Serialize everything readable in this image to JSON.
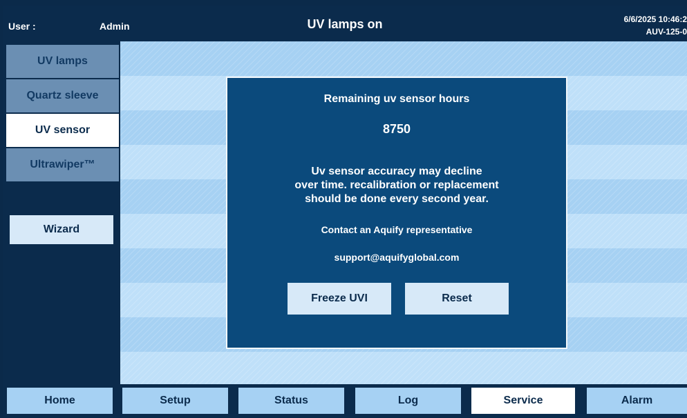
{
  "header": {
    "user_label": "User :",
    "user_name": "Admin",
    "title": "UV lamps on",
    "datetime": "6/6/2025 10:46:2",
    "device_id": "AUV-125-0"
  },
  "sidebar": {
    "items": [
      {
        "label": "UV lamps",
        "active": false
      },
      {
        "label": "Quartz sleeve",
        "active": false
      },
      {
        "label": "UV sensor",
        "active": true
      },
      {
        "label": "Ultrawiper™",
        "active": false
      }
    ],
    "wizard_label": "Wizard"
  },
  "dialog": {
    "title": "Remaining uv sensor hours",
    "value": "8750",
    "message_lines": [
      "Uv sensor accuracy may decline",
      "over time. recalibration or replacement",
      "should be done every second year."
    ],
    "contact": "Contact an Aquify representative",
    "email": "support@aquifyglobal.com",
    "freeze_label": "Freeze UVI",
    "reset_label": "Reset"
  },
  "bottom_nav": {
    "items": [
      {
        "label": "Home",
        "active": false
      },
      {
        "label": "Setup",
        "active": false
      },
      {
        "label": "Status",
        "active": false
      },
      {
        "label": "Log",
        "active": false
      },
      {
        "label": "Service",
        "active": true
      },
      {
        "label": "Alarm",
        "active": false
      }
    ]
  },
  "colors": {
    "background": "#0b2b4c",
    "dialog": "#0b4a7c",
    "stripe_dark": "#a6d1f3",
    "stripe_light": "#bfe0f9",
    "sidebar_inactive": "#6b8fb3",
    "button": "#d7e9f8"
  }
}
